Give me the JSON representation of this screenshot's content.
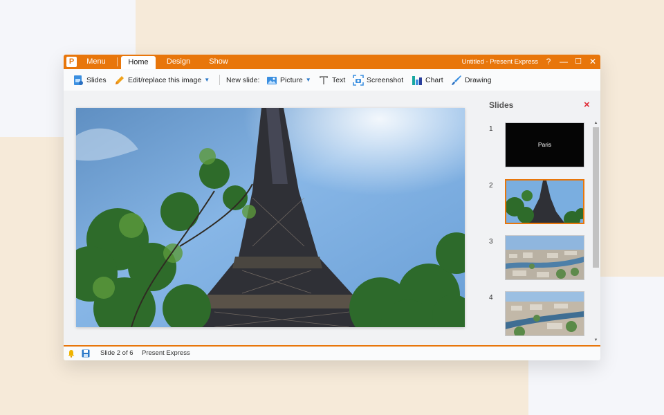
{
  "app": {
    "logo_letter": "P",
    "menu_label": "Menu",
    "tabs": [
      {
        "label": "Home",
        "active": true
      },
      {
        "label": "Design",
        "active": false
      },
      {
        "label": "Show",
        "active": false
      }
    ],
    "window_title": "Untitled - Present Express",
    "controls": {
      "help": "?",
      "minimize": "—",
      "maximize": "☐",
      "close": "✕"
    }
  },
  "toolbar": {
    "slides_label": "Slides",
    "edit_image_label": "Edit/replace this image",
    "new_slide_label": "New slide:",
    "picture_label": "Picture",
    "text_label": "Text",
    "screenshot_label": "Screenshot",
    "chart_label": "Chart",
    "drawing_label": "Drawing"
  },
  "panel": {
    "title": "Slides",
    "close_icon": "×",
    "thumbnails": [
      {
        "number": "1",
        "text": "Paris",
        "kind": "black-title"
      },
      {
        "number": "2",
        "text": "",
        "kind": "eiffel-tower-photo",
        "selected": true
      },
      {
        "number": "3",
        "text": "",
        "kind": "paris-city-photo"
      },
      {
        "number": "4",
        "text": "",
        "kind": "paris-river-photo"
      }
    ]
  },
  "status": {
    "slide_counter": "Slide 2 of 6",
    "app_name": "Present Express"
  },
  "colors": {
    "accent": "#e8760b",
    "close_red": "#e0303a",
    "icon_blue": "#2a78c8"
  }
}
